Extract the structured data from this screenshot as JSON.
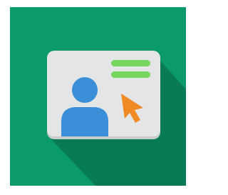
{
  "icon": {
    "name": "profile-card-cursor-icon",
    "colors": {
      "background": "#0b9a6c",
      "shadow": "#087a55",
      "card": "#e3e5e6",
      "card_edge": "#c9cccd",
      "avatar": "#3b8fd8",
      "lines": "#77d65e",
      "cursor": "#f08a24"
    },
    "parts": [
      "card-icon",
      "avatar-icon",
      "text-lines-icon",
      "cursor-arrow-icon"
    ]
  }
}
